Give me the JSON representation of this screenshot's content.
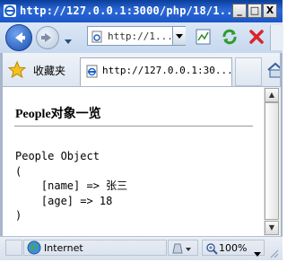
{
  "window": {
    "title": "http://127.0.0.1:3000/php/18/1...",
    "buttons": {
      "minimize": "_",
      "maximize": "□",
      "close": "X"
    }
  },
  "navbar": {
    "address": "http://1..."
  },
  "favorites": {
    "label": "收藏夹"
  },
  "tab": {
    "title": "http://127.0.0.1:30..."
  },
  "page": {
    "heading": "People对象一览",
    "dump": "People Object\n(\n    [name] => 张三\n    [age] => 18\n)"
  },
  "statusbar": {
    "zone": "Internet",
    "zoom": "100%"
  },
  "scrollbar": {
    "up": "▲",
    "down": "▼"
  }
}
